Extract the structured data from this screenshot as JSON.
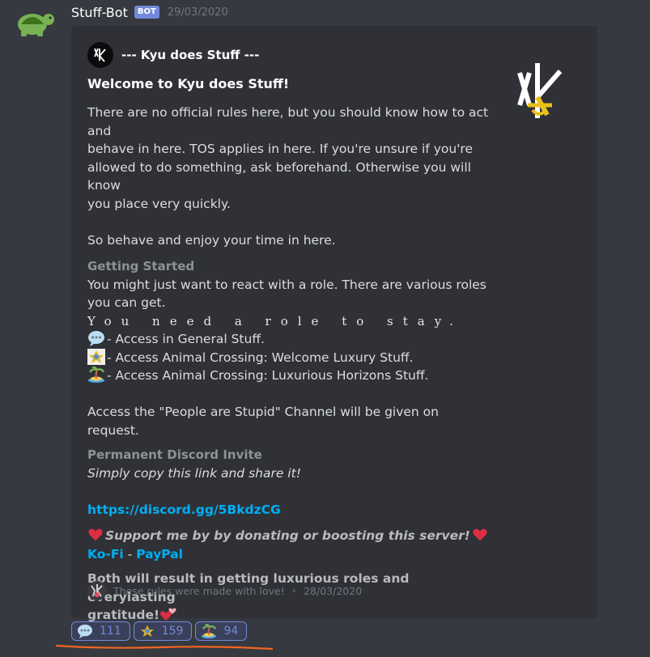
{
  "message": {
    "username": "Stuff-Bot",
    "bot_tag": "BOT",
    "timestamp": "29/03/2020",
    "avatar_icon": "turtle-icon"
  },
  "embed": {
    "author": "--- Kyu does Stuff ---",
    "author_icon": "kyu-logo-icon",
    "thumbnail_icon": "kyu-logo-gold-icon",
    "title": "Welcome to Kyu does Stuff!",
    "desc_lines": [
      "There are no official rules here, but you should know how to act and",
      "behave in here. TOS applies in here. If you're unsure if you're",
      "allowed to do something, ask beforehand. Otherwise you will know",
      "you place very quickly."
    ],
    "behave_line": "So behave and enjoy your time in here.",
    "getting_started": {
      "title": "Getting Started",
      "lines": [
        "You might just want to react with a role. There are various roles",
        "you can get."
      ],
      "need_role": "You need a role to stay.",
      "roles": [
        {
          "icon": "speech-bubble-icon",
          "text": "- Access in General Stuff."
        },
        {
          "icon": "acnl-icon",
          "text": "- Access Animal Crossing: Welcome Luxury Stuff."
        },
        {
          "icon": "island-icon",
          "text": "- Access Animal Crossing: Luxurious Horizons Stuff."
        }
      ],
      "request_line": "Access the \"People are Stupid\" Channel will be given on request."
    },
    "invite": {
      "title": "Permanent Discord Invite",
      "subtitle": "Simply copy this link and share it!",
      "link": "https://discord.gg/5BkdzCG"
    },
    "support": {
      "text": "Support me by by donating or boosting this server!",
      "kofi": "Ko-Fi",
      "separator": "-",
      "paypal": "PayPal",
      "result_line1": "Both will result in getting luxurious roles and everylasting",
      "result_line2": "gratitude!"
    },
    "footer": {
      "text": "These rules were made with love!",
      "dot": "•",
      "date": "28/03/2020"
    }
  },
  "reactions": [
    {
      "icon": "speech-bubble-icon",
      "count": "111"
    },
    {
      "icon": "acnl-icon",
      "count": "159"
    },
    {
      "icon": "island-icon",
      "count": "94"
    }
  ],
  "colors": {
    "background": "#36393f",
    "embed": "#2f3136",
    "link": "#00aff4",
    "blurple": "#7289da",
    "annotation": "#f26522"
  }
}
